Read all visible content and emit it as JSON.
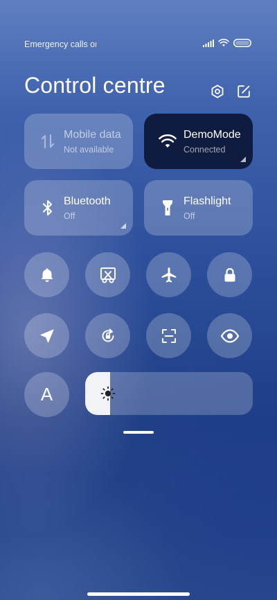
{
  "status_bar": {
    "carrier_text": "Emergency calls only"
  },
  "header": {
    "title": "Control centre"
  },
  "tiles": {
    "mobile_data": {
      "name": "Mobile data",
      "status": "Not available"
    },
    "wifi": {
      "name": "DemoMode",
      "status": "Connected"
    },
    "bluetooth": {
      "name": "Bluetooth",
      "status": "Off"
    },
    "flashlight": {
      "name": "Flashlight",
      "status": "Off"
    }
  },
  "toggles": {
    "row1": [
      "bell-icon",
      "screenshot-scissors-icon",
      "airplane-icon",
      "lock-icon"
    ],
    "row2": [
      "location-icon",
      "rotation-lock-icon",
      "scan-icon",
      "eye-icon"
    ],
    "auto_brightness_label": "A"
  },
  "brightness": {
    "level": 0.15
  },
  "colors": {
    "tile_bg": "#ffffff38",
    "active_tile_bg": "#0f1c3f",
    "slider_fill": "#f2f3f6"
  }
}
